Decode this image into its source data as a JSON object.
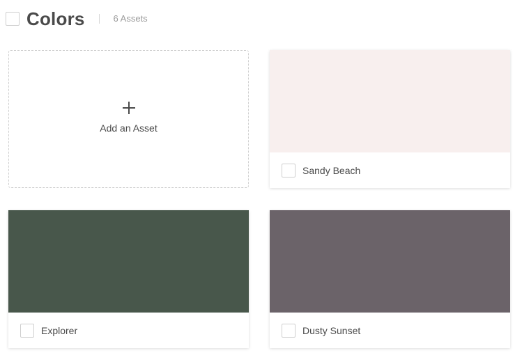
{
  "header": {
    "title": "Colors",
    "asset_count": "6 Assets"
  },
  "add_card": {
    "label": "Add an Asset",
    "icon": "plus-icon"
  },
  "colors": [
    {
      "name": "Sandy Beach",
      "hex": "#f8efee"
    },
    {
      "name": "Explorer",
      "hex": "#48574b"
    },
    {
      "name": "Dusty Sunset",
      "hex": "#6b6369"
    }
  ]
}
